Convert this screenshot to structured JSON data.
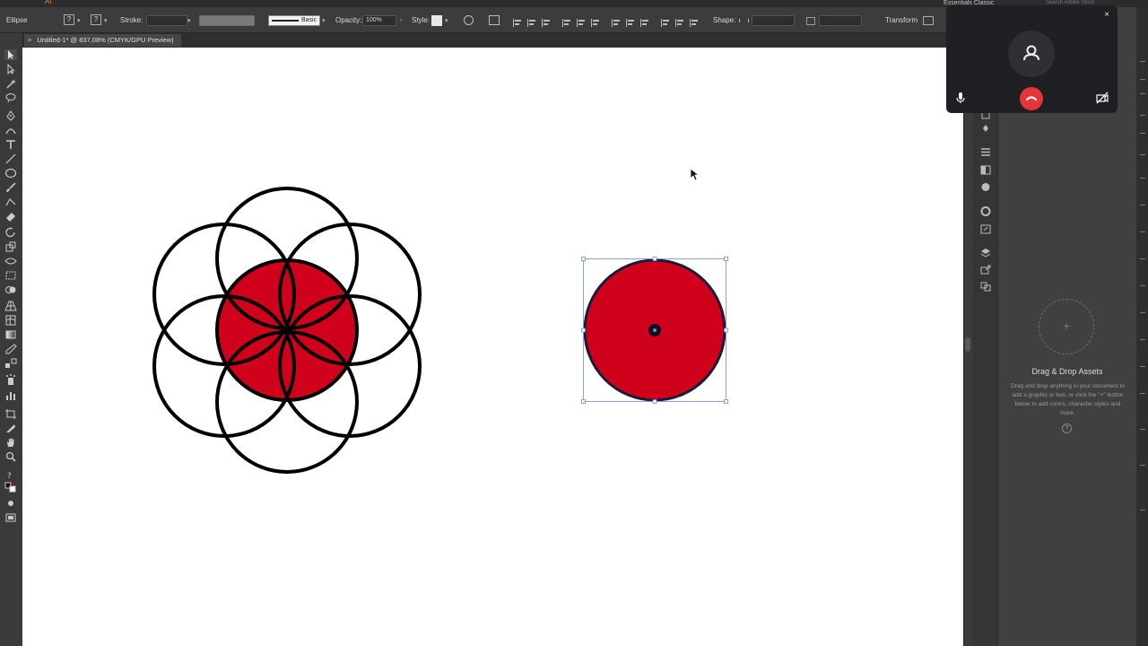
{
  "app": {
    "logo": "Ai",
    "workspace": "Essentials Classic",
    "search_placeholder": "Search Adobe Stock"
  },
  "control_bar": {
    "object_type": "Ellipse",
    "stroke_label": "Stroke:",
    "brush_label": "Basic",
    "opacity_label": "Opacity:",
    "opacity_value": "100%",
    "style_label": "Style:",
    "shape_label": "Shape:",
    "transform_label": "Transform"
  },
  "document": {
    "tab_title": "Untitled-1* @ 837,08% (CMYK/GPU Preview)",
    "close_glyph": "×"
  },
  "colors": {
    "accent_red": "#d0021b",
    "selection_blue": "#6f8ad6",
    "hangup_red": "#e5343a"
  },
  "assets_panel": {
    "plus_glyph": "+",
    "title": "Drag & Drop Assets",
    "description": "Drag and drop anything in your document to add a graphic or text, or click the \"+\" button below to add colors, character styles and more.",
    "help_glyph": "?"
  },
  "call_overlay": {
    "close_glyph": "×"
  },
  "icons": [
    "selection-tool-icon",
    "direct-selection-icon",
    "magic-wand-icon",
    "lasso-icon",
    "pen-icon",
    "type-icon",
    "line-icon",
    "ellipse-icon",
    "paintbrush-icon",
    "eraser-icon",
    "rotate-icon",
    "scale-icon",
    "width-icon",
    "shape-builder-icon",
    "gradient-icon",
    "eyedropper-icon",
    "blend-icon",
    "symbol-sprayer-icon",
    "graph-icon",
    "artboard-icon",
    "slice-icon",
    "hand-icon",
    "zoom-icon",
    "mic-icon",
    "hangup-icon",
    "camera-off-icon",
    "person-icon"
  ]
}
